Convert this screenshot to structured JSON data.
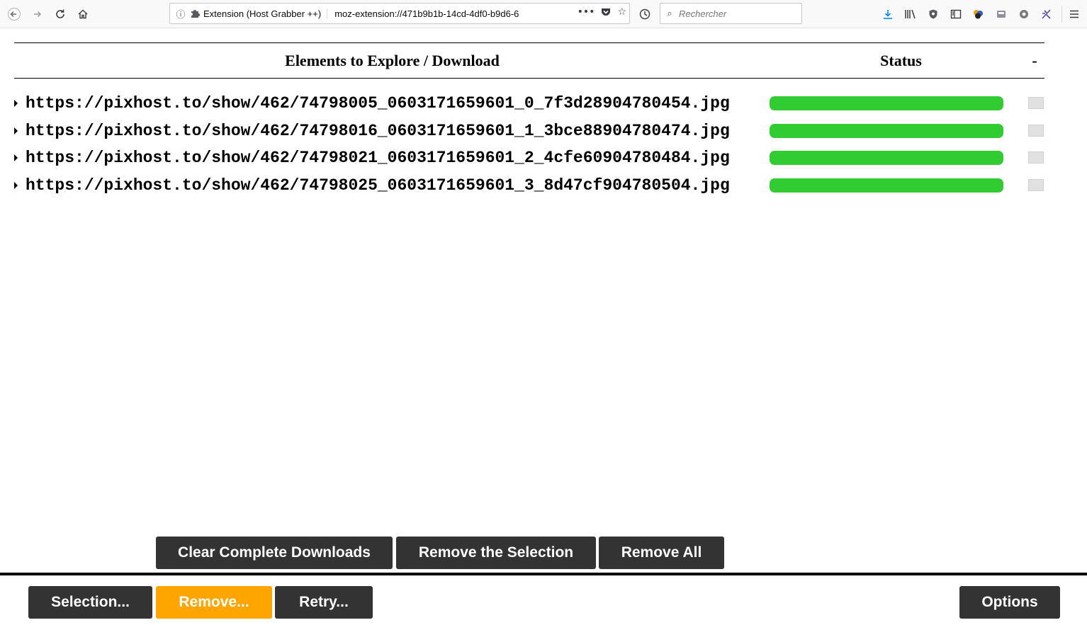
{
  "browser": {
    "url_ext_name": "Extension (Host Grabber ++)",
    "url": "moz-extension://471b9b1b-14cd-4df0-b9d6-6",
    "search_placeholder": "Rechercher"
  },
  "table": {
    "header_elements": "Elements to Explore / Download",
    "header_status": "Status",
    "header_dash": "-",
    "rows": [
      {
        "url": "https://pixhost.to/show/462/74798005_0603171659601_0_7f3d28904780454.jpg",
        "progress": 100
      },
      {
        "url": "https://pixhost.to/show/462/74798016_0603171659601_1_3bce88904780474.jpg",
        "progress": 100
      },
      {
        "url": "https://pixhost.to/show/462/74798021_0603171659601_2_4cfe60904780484.jpg",
        "progress": 100
      },
      {
        "url": "https://pixhost.to/show/462/74798025_0603171659601_3_8d47cf904780504.jpg",
        "progress": 100
      }
    ]
  },
  "actions": {
    "clear_complete": "Clear Complete Downloads",
    "remove_selection": "Remove the Selection",
    "remove_all": "Remove All"
  },
  "footer": {
    "selection": "Selection...",
    "remove": "Remove...",
    "retry": "Retry...",
    "options": "Options"
  },
  "colors": {
    "progress_fill": "#31cc31",
    "button_dark": "#333333",
    "button_active": "#ffa500"
  }
}
